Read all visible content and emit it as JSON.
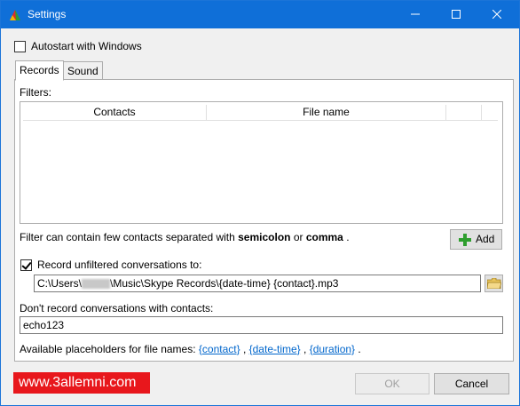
{
  "window": {
    "title": "Settings",
    "controls": {
      "minimize": "—",
      "maximize": "☐",
      "close": "✕"
    }
  },
  "autostart": {
    "label": "Autostart with Windows",
    "checked": false
  },
  "tabs": [
    {
      "label": "Records",
      "active": true
    },
    {
      "label": "Sound",
      "active": false
    }
  ],
  "records": {
    "filters_label": "Filters:",
    "columns": [
      "Contacts",
      "File name"
    ],
    "filter_hint": {
      "prefix": "Filter can contain few contacts separated with ",
      "bold1": "semicolon",
      "middle": " or ",
      "bold2": "comma",
      "suffix": " ."
    },
    "add_button": "Add",
    "record_unfiltered": {
      "label": "Record unfiltered conversations to:",
      "checked": true
    },
    "path_value": "C:\\Users\\",
    "path_value_rest": "\\Music\\Skype Records\\{date-time} {contact}.mp3",
    "dont_record_label": "Don't record conversations with contacts:",
    "dont_record_value": "echo123",
    "placeholders": {
      "prefix": "Available placeholders for file names: ",
      "items": [
        "{contact}",
        "{date-time}",
        "{duration}"
      ],
      "sep": " , ",
      "suffix": " ."
    }
  },
  "footer": {
    "ok_label": "OK",
    "cancel_label": "Cancel",
    "watermark": "www.3allemni.com"
  },
  "colors": {
    "titlebar": "#0f6fd8",
    "link": "#0066cc",
    "watermark": "#e8171c",
    "add_icon": "#2e9e2e"
  }
}
